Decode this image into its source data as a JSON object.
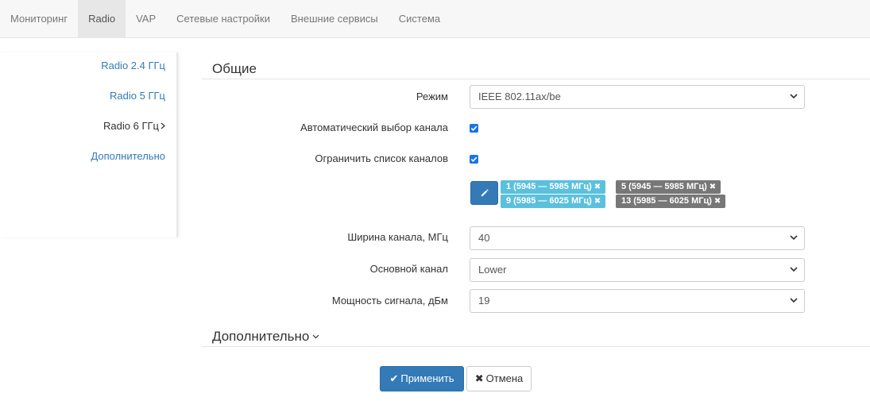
{
  "topnav": {
    "tabs": [
      {
        "label": "Мониторинг"
      },
      {
        "label": "Radio"
      },
      {
        "label": "VAP"
      },
      {
        "label": "Сетевые настройки"
      },
      {
        "label": "Внешние сервисы"
      },
      {
        "label": "Система"
      }
    ],
    "active": "Radio"
  },
  "sidebar": {
    "items": [
      {
        "label": "Radio 2.4 ГГц"
      },
      {
        "label": "Radio 5 ГГц"
      },
      {
        "label": "Radio 6 ГГц"
      },
      {
        "label": "Дополнительно"
      }
    ],
    "active": "Radio 6 ГГц"
  },
  "general": {
    "title": "Общие",
    "mode": {
      "label": "Режим",
      "value": "IEEE 802.11ax/be"
    },
    "auto_channel": {
      "label": "Автоматический выбор канала",
      "checked": true
    },
    "limit_channels": {
      "label": "Ограничить список каналов",
      "checked": true
    },
    "channels": [
      {
        "label": "1 (5945 — 5985 МГц)",
        "style": "info"
      },
      {
        "label": "5 (5945 — 5985 МГц)",
        "style": "gray"
      },
      {
        "label": "9 (5985 — 6025 МГц)",
        "style": "info"
      },
      {
        "label": "13 (5985 — 6025 МГц)",
        "style": "gray"
      }
    ],
    "width": {
      "label": "Ширина канала, МГц",
      "value": "40"
    },
    "primary": {
      "label": "Основной канал",
      "value": "Lower"
    },
    "power": {
      "label": "Мощность сигнала, дБм",
      "value": "19"
    }
  },
  "advanced": {
    "title": "Дополнительно"
  },
  "actions": {
    "apply_label": "Применить",
    "cancel_label": "Отмена"
  },
  "colors": {
    "primary": "#337ab7",
    "tag_info": "#5bc0de",
    "tag_gray": "#777777",
    "checkbox": "#1a73e8"
  },
  "icons": {
    "sidebar_active": "chevron-right-icon",
    "section_collapse": "chevron-down-icon",
    "edit": "pencil-icon",
    "tag_remove": "times-icon",
    "apply": "check-icon",
    "cancel": "times-icon"
  }
}
